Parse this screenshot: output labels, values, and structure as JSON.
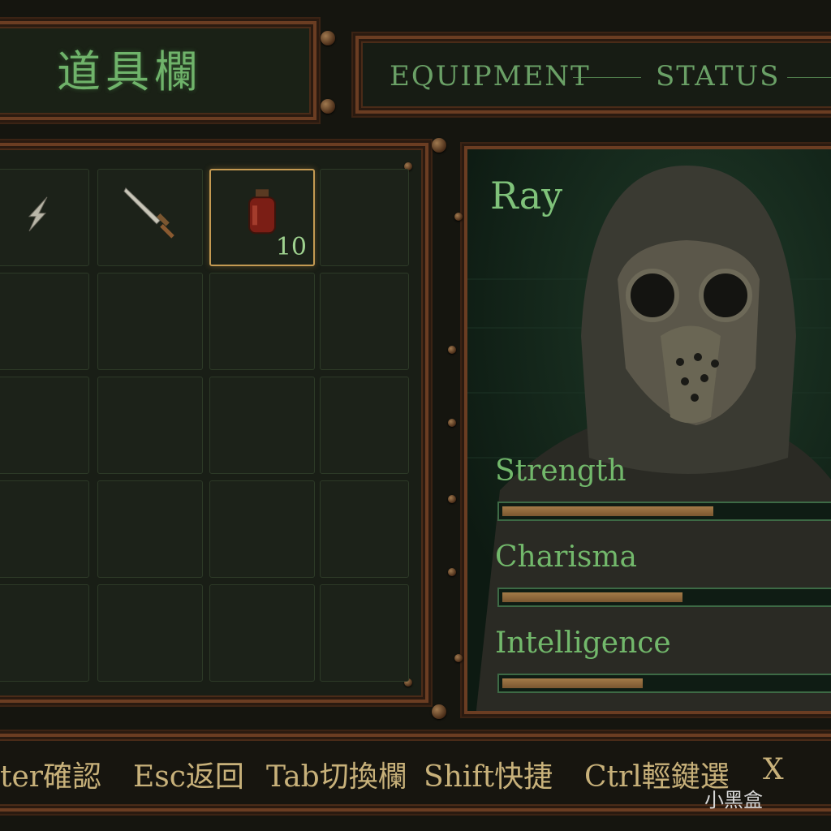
{
  "header": {
    "title": "道具欄",
    "tabs": [
      {
        "label": "EQUIPMENT"
      },
      {
        "label": "STATUS"
      }
    ]
  },
  "inventory": {
    "items": [
      {
        "icon": "shard-icon"
      },
      {
        "icon": "sword-icon"
      },
      {
        "icon": "potion-icon",
        "quantity": "10",
        "selected": true
      }
    ]
  },
  "character": {
    "name": "Ray",
    "stats": [
      {
        "label": "Strength",
        "value": 0.63
      },
      {
        "label": "Charisma",
        "value": 0.54
      },
      {
        "label": "Intelligence",
        "value": 0.42
      }
    ]
  },
  "footer": {
    "hints": [
      "ter確認",
      "Esc返回",
      "Tab切換欄",
      "Shift快捷",
      "Ctrl輕鍵選",
      "X"
    ]
  },
  "watermark": "小黑盒",
  "colors": {
    "accent_green": "#6fb36a",
    "bar_fill": "#a37a48",
    "frame_copper": "#6b3d22"
  }
}
